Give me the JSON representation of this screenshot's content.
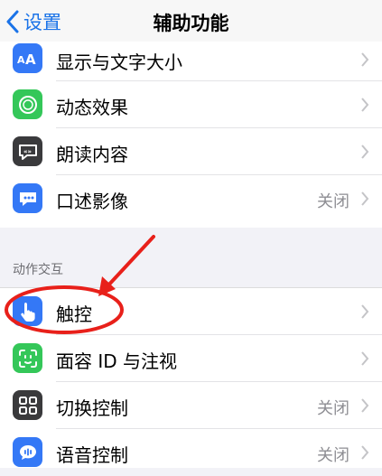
{
  "nav": {
    "back_label": "设置",
    "title": "辅助功能"
  },
  "group_vision": {
    "items": [
      {
        "label": "显示与文字大小",
        "value": "",
        "icon": "text-size-icon",
        "color": "#3478f6"
      },
      {
        "label": "动态效果",
        "value": "",
        "icon": "motion-icon",
        "color": "#34c759"
      },
      {
        "label": "朗读内容",
        "value": "",
        "icon": "spoken-content-icon",
        "color": "#3a3a3c"
      },
      {
        "label": "口述影像",
        "value": "关闭",
        "icon": "audio-description-icon",
        "color": "#3478f6"
      }
    ]
  },
  "section_interaction": {
    "header": "动作交互",
    "items": [
      {
        "label": "触控",
        "value": "",
        "icon": "touch-hand-icon",
        "color": "#3478f6"
      },
      {
        "label": "面容 ID 与注视",
        "value": "",
        "icon": "face-id-icon",
        "color": "#34c759"
      },
      {
        "label": "切换控制",
        "value": "关闭",
        "icon": "switch-control-icon",
        "color": "#3a3a3c"
      },
      {
        "label": "语音控制",
        "value": "关闭",
        "icon": "voice-control-icon",
        "color": "#3478f6"
      }
    ]
  },
  "annotation": {
    "color": "#e8201a"
  }
}
